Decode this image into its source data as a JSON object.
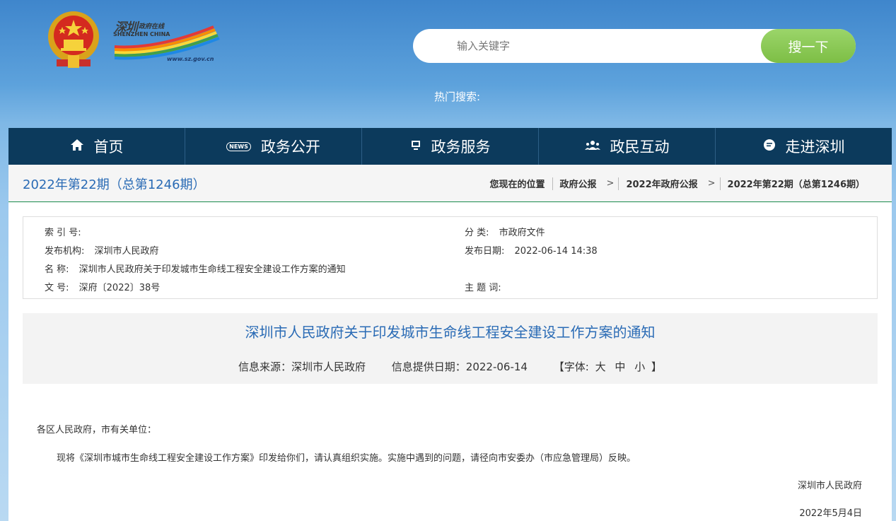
{
  "header": {
    "logo_cn": "深圳",
    "logo_cn2": "政府在线",
    "logo_en": "SHENZHEN CHINA",
    "logo_url": "www.sz.gov.cn",
    "search_placeholder": "输入关键字",
    "search_button": "搜一下",
    "hot_search_label": "热门搜索:"
  },
  "nav": {
    "items": [
      {
        "label": "首页",
        "icon": "home-icon"
      },
      {
        "label": "政务公开",
        "icon": "news-icon"
      },
      {
        "label": "政务服务",
        "icon": "monitor-icon"
      },
      {
        "label": "政民互动",
        "icon": "users-icon"
      },
      {
        "label": "走进深圳",
        "icon": "chat-icon"
      }
    ]
  },
  "issue": {
    "title": "2022年第22期（总第1246期）"
  },
  "breadcrumb": {
    "prefix": "您现在的位置",
    "items": [
      "政府公报",
      "2022年政府公报",
      "2022年第22期（总第1246期）"
    ],
    "sep": ">"
  },
  "meta": {
    "index_label": "索 引 号:",
    "index_value": "",
    "category_label": "分 类:",
    "category_value": "市政府文件",
    "publisher_label": "发布机构:",
    "publisher_value": "深圳市人民政府",
    "date_label": "发布日期:",
    "date_value": "2022-06-14 14:38",
    "name_label": "名 称:",
    "name_value": "深圳市人民政府关于印发城市生命线工程安全建设工作方案的通知",
    "docno_label": "文 号:",
    "docno_value": "深府〔2022〕38号",
    "keywords_label": "主 题 词:",
    "keywords_value": ""
  },
  "article": {
    "title": "深圳市人民政府关于印发城市生命线工程安全建设工作方案的通知",
    "source": "信息来源：深圳市人民政府",
    "provide_date": "信息提供日期：2022-06-14",
    "font_label_open": "【字体:",
    "font_large": "大",
    "font_medium": "中",
    "font_small": "小",
    "font_label_close": "】",
    "salutation": "各区人民政府，市有关单位：",
    "paragraph": "现将《深圳市城市生命线工程安全建设工作方案》印发给你们，请认真组织实施。实施中遇到的问题，请径向市安委办（市应急管理局）反映。",
    "signature": "深圳市人民政府",
    "sign_date": "2022年5月4日"
  }
}
